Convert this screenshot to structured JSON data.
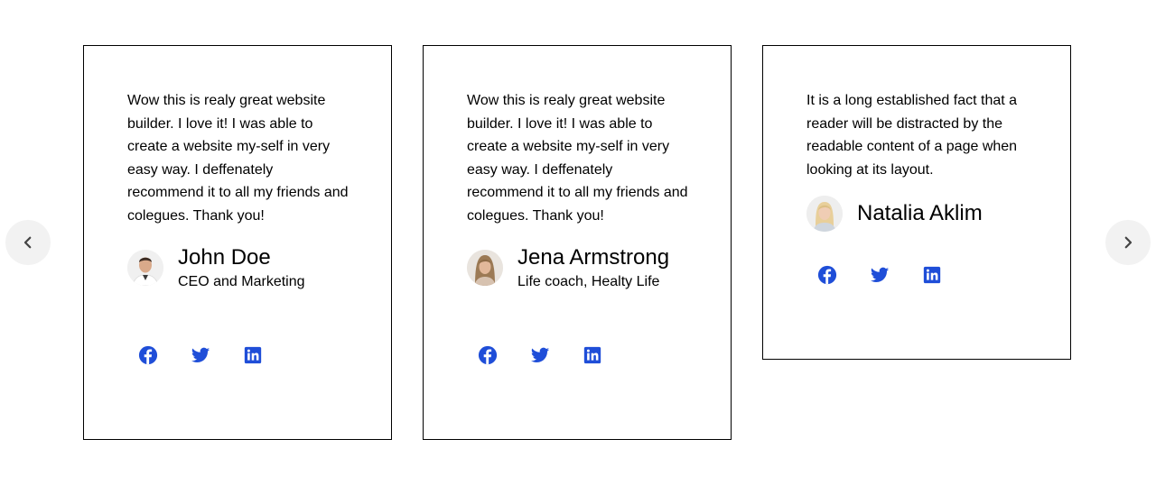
{
  "colors": {
    "accent": "#1f4ed8",
    "nav_bg": "#f2f2f2",
    "border": "#000000"
  },
  "nav": {
    "prev_icon": "chevron-left-icon",
    "next_icon": "chevron-right-icon"
  },
  "testimonials": [
    {
      "quote": "Wow this is realy great website builder. I love it! I was able to create a website my-self in very easy way. I deffenately recommend it to all my friends and colegues. Thank you!",
      "name": "John Doe",
      "role": "CEO and Marketing",
      "avatar": "avatar-man-icon",
      "socials": [
        "facebook-icon",
        "twitter-icon",
        "linkedin-icon"
      ]
    },
    {
      "quote": "Wow this is realy great website builder. I love it! I was able to create a website my-self in very easy way. I deffenately recommend it to all my friends and colegues. Thank you!",
      "name": "Jena Armstrong",
      "role": "Life coach, Healty Life",
      "avatar": "avatar-woman-icon",
      "socials": [
        "facebook-icon",
        "twitter-icon",
        "linkedin-icon"
      ]
    },
    {
      "quote": "It is a long established fact that a reader will be distracted by the readable content of a page when looking at its layout.",
      "name": "Natalia Aklim",
      "role": "",
      "avatar": "avatar-woman-icon",
      "socials": [
        "facebook-icon",
        "twitter-icon",
        "linkedin-icon"
      ]
    }
  ]
}
